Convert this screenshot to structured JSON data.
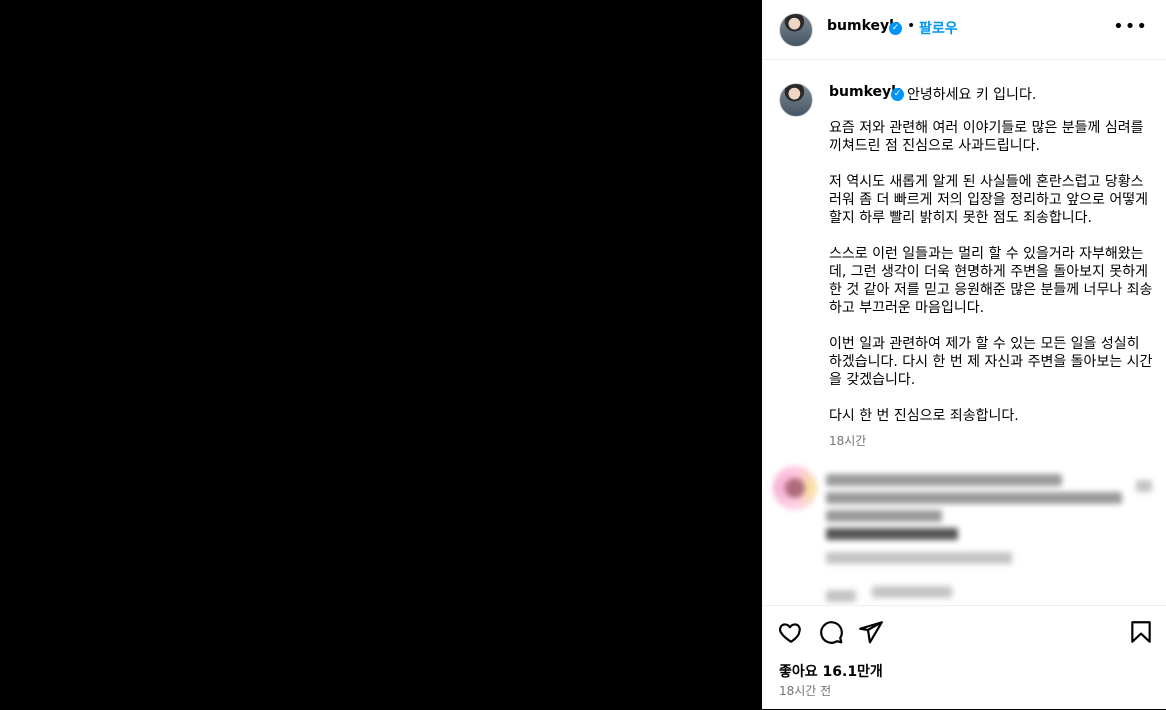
{
  "header": {
    "username": "bumkeyk",
    "separator": "•",
    "follow_label": "팔로우",
    "more_label": "•••"
  },
  "caption": {
    "username": "bumkeyk",
    "first_line": "안녕하세요 키 입니다.",
    "paragraphs": [
      "요즘 저와 관련해 여러 이야기들로 많은 분들께 심려를 끼쳐드린 점 진심으로 사과드립니다.",
      "저 역시도 새롭게 알게 된 사실들에 혼란스럽고 당황스러워 좀 더 빠르게 저의 입장을 정리하고 앞으로 어떻게 할지 하루 빨리 밝히지 못한 점도 죄송합니다.",
      "스스로 이런 일들과는 멀리 할 수 있을거라 자부해왔는데, 그런 생각이 더욱 현명하게 주변을 돌아보지 못하게 한 것 같아 저를 믿고 응원해준 많은 분들께 너무나 죄송하고 부끄러운 마음입니다.",
      "이번 일과 관련하여 제가 할 수 있는 모든 일을 성실히 하겠습니다. 다시 한 번 제 자신과 주변을 돌아보는 시간을 갖겠습니다.",
      "다시 한 번 진심으로 죄송합니다."
    ],
    "time": "18시간"
  },
  "icons": {
    "like": "heart-icon",
    "comment": "comment-icon",
    "share": "share-icon",
    "save": "bookmark-icon",
    "verified": "verified-badge-icon",
    "more": "more-options-icon"
  },
  "footer": {
    "likes": "좋아요 16.1만개",
    "time": "18시간 전"
  },
  "colors": {
    "accent": "#0095f6",
    "muted": "#737373",
    "border": "#efefef"
  }
}
